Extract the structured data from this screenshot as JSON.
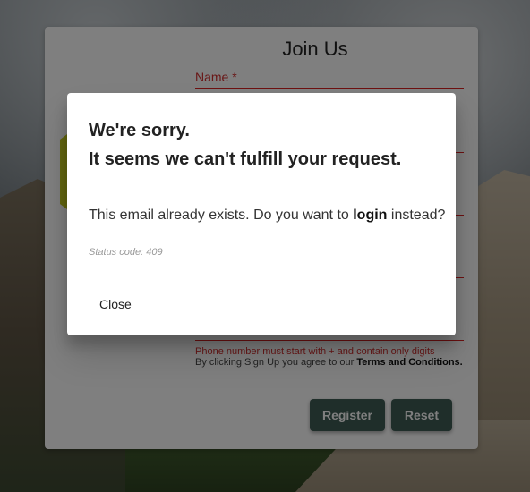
{
  "form": {
    "title": "Join Us",
    "name_label": "Name *",
    "phone_error": "Phone number must start with + and contain only digits",
    "terms_prefix": "By clicking Sign Up you agree to our ",
    "terms_link": "Terms and Conditions.",
    "register_label": "Register",
    "reset_label": "Reset"
  },
  "dialog": {
    "title_line1": "We're sorry.",
    "title_line2": "It seems we can't fulfill your request.",
    "message_prefix": "This email already exists. Do you want to ",
    "message_link": "login",
    "message_suffix": " instead?",
    "status": "Status code: 409",
    "close_label": "Close"
  },
  "colors": {
    "button": "#3f5c55",
    "error": "#d32f2f",
    "logo": "#c6cc1e"
  }
}
